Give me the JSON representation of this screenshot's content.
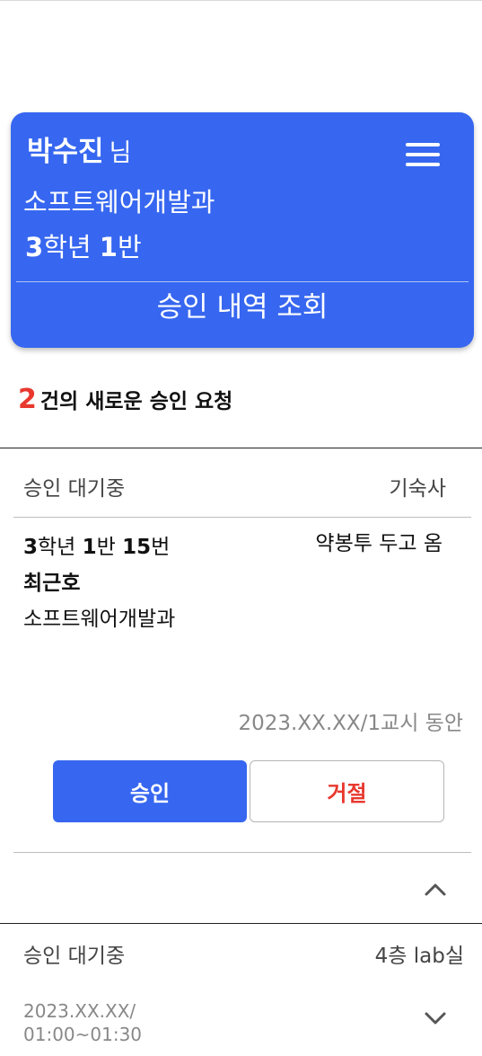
{
  "profile": {
    "name": "박수진",
    "honorific": "님",
    "department": "소프트웨어개발과",
    "grade_num": "3",
    "grade_word": "학년 ",
    "class_num": "1",
    "class_word": "반",
    "history_link": "승인 내역 조회"
  },
  "summary": {
    "count": "2",
    "text": "건의 새로운 승인 요청"
  },
  "requests": [
    {
      "status": "승인 대기중",
      "place": "기숙사",
      "grade_num": "3",
      "grade_word": "학년 ",
      "class_num": "1",
      "class_word": "반 ",
      "number": "15",
      "number_word": "번",
      "student_name": "최근호",
      "department": "소프트웨어개발과",
      "reason": "약봉투 두고 옴",
      "period": "2023.XX.XX/1교시 동안",
      "approve_label": "승인",
      "reject_label": "거절",
      "expanded": true
    },
    {
      "status": "승인 대기중",
      "place": "4층 lab실",
      "date_line1": "2023.XX.XX/",
      "date_line2": "01:00~01:30",
      "expanded": false
    }
  ],
  "colors": {
    "primary": "#3767f0",
    "danger": "#e8382e",
    "muted": "#888888"
  }
}
